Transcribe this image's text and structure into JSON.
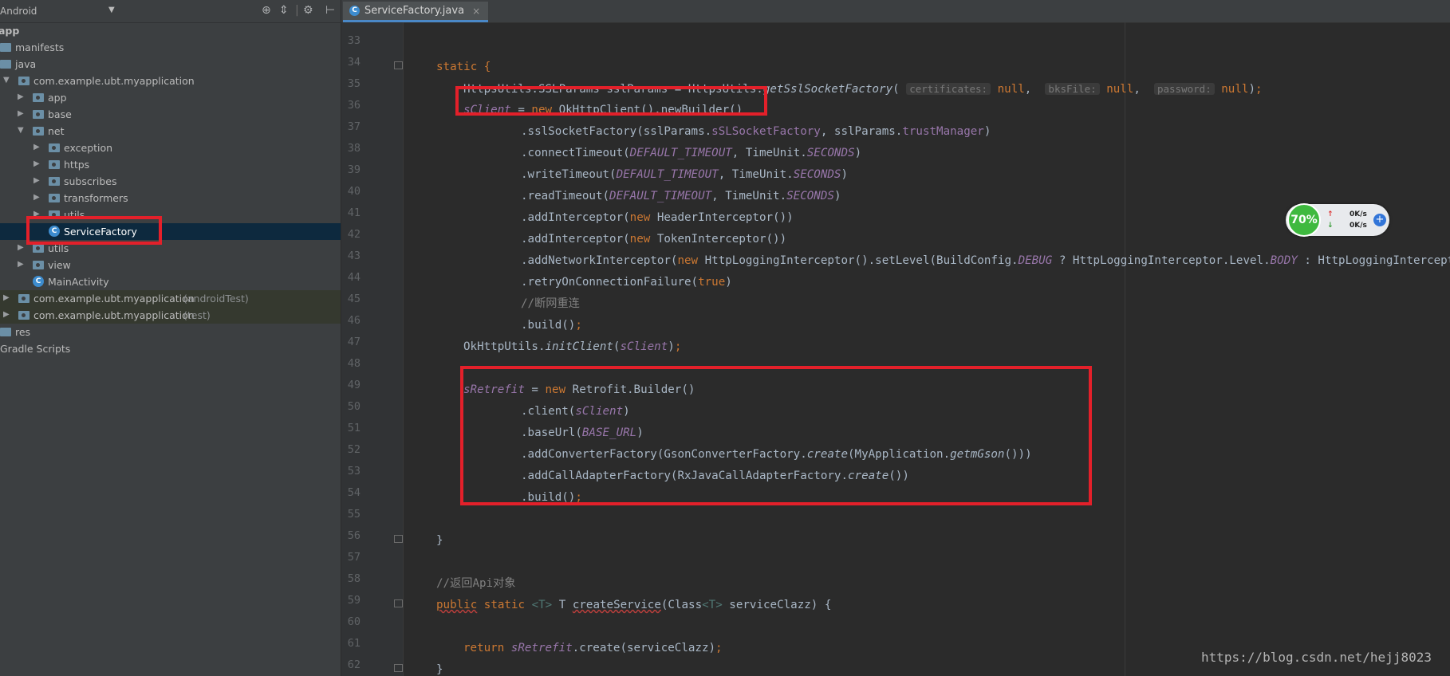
{
  "project": {
    "view_mode": "Android",
    "tree": [
      {
        "label": "app",
        "bold": true,
        "type": "module"
      },
      {
        "label": "manifests",
        "type": "folder"
      },
      {
        "label": "java",
        "type": "folder"
      },
      {
        "label": "com.example.ubt.myapplication",
        "type": "package",
        "expanded": true
      },
      {
        "label": "app",
        "type": "package"
      },
      {
        "label": "base",
        "type": "package"
      },
      {
        "label": "net",
        "type": "package",
        "expanded": true
      },
      {
        "label": "exception",
        "type": "package"
      },
      {
        "label": "https",
        "type": "package"
      },
      {
        "label": "subscribes",
        "type": "package"
      },
      {
        "label": "transformers",
        "type": "package"
      },
      {
        "label": "utils",
        "type": "package"
      },
      {
        "label": "ServiceFactory",
        "type": "class",
        "selected": true
      },
      {
        "label": "utils",
        "type": "package"
      },
      {
        "label": "view",
        "type": "package"
      },
      {
        "label": "MainActivity",
        "type": "class"
      },
      {
        "label": "com.example.ubt.myapplication",
        "suffix": "(androidTest)",
        "type": "package"
      },
      {
        "label": "com.example.ubt.myapplication",
        "suffix": "(test)",
        "type": "package"
      },
      {
        "label": "res",
        "type": "folder"
      },
      {
        "label": "Gradle Scripts",
        "type": "gradle"
      }
    ]
  },
  "editor": {
    "tab": {
      "label": "ServiceFactory.java",
      "close": "×"
    },
    "line_numbers": [
      "33",
      "34",
      "35",
      "36",
      "37",
      "38",
      "39",
      "40",
      "41",
      "42",
      "43",
      "44",
      "45",
      "46",
      "47",
      "48",
      "49",
      "50",
      "51",
      "52",
      "53",
      "54",
      "55",
      "56",
      "57",
      "58",
      "59",
      "60",
      "61",
      "62"
    ],
    "code": {
      "l34": "static {",
      "l35_a": "HttpsUtils.SSLParams sslParams = HttpsUtils.",
      "l35_m": "getSslSocketFactory",
      "l35_h1": "certificates:",
      "l35_h2": "bksFile:",
      "l35_h3": "password:",
      "null": "null",
      "l36_f": "sClient",
      "l36_b": " = ",
      "new": "new",
      "l36_c": " OkHttpClient().newBuilder()",
      "l37_a": ".sslSocketFactory(sslParams.",
      "l37_f": "sSLSocketFactory",
      "l37_b": ", sslParams.",
      "l37_g": "trustManager",
      "l37_c": ")",
      "connectTimeout": ".connectTimeout(",
      "writeTimeout": ".writeTimeout(",
      "readTimeout": ".readTimeout(",
      "default_timeout": "DEFAULT_TIMEOUT",
      "timeunit": ", TimeUnit.",
      "seconds": "SECONDS",
      "addInterceptor": ".addInterceptor(",
      "header_interceptor": " HeaderInterceptor())",
      "token_interceptor": " TokenInterceptor())",
      "l43_a": ".addNetworkInterceptor(",
      "l43_b": " HttpLoggingInterceptor().setLevel(BuildConfig.",
      "l43_debug": "DEBUG",
      "l43_c": " ? HttpLoggingInterceptor.Level.",
      "l43_body": "BODY",
      "l43_d": " : HttpLoggingInterceptor.Level.NONE))",
      "l44_a": ".retryOnConnectionFailure(",
      "true": "true",
      "l45": "//断网重连",
      "build": ".build()",
      "semi": ";",
      "l47_a": "OkHttpUtils.",
      "l47_m": "initClient",
      "l47_f": "sClient",
      "l49_f": "sRetrefit",
      "l49_c": " Retrofit.Builder()",
      "l50_a": ".client(",
      "l50_f": "sClient",
      "l51_a": ".baseUrl(",
      "l51_f": "BASE_URL",
      "l52_a": ".addConverterFactory(GsonConverterFactory.",
      "create": "create",
      "l52_b": "(MyApplication.",
      "l52_m": "getmGson",
      "l52_c": "()))",
      "l53_a": ".addCallAdapterFactory(RxJavaCallAdapterFactory.",
      "l53_c": "())",
      "close_brace": "}",
      "l58": "//返回Api对象",
      "l59_pub": "public",
      "l59_static": "static",
      "l59_t1": "<T>",
      "l59_t2": " T ",
      "l59_m": "createService",
      "l59_b": "(Class",
      "l59_c": " serviceClazz) {",
      "l61_ret": "return",
      "l61_f": "sRetrefit",
      "l61_b": ".create(serviceClazz)"
    }
  },
  "net_widget": {
    "cpu": "70%",
    "up": "0K/s",
    "down": "0K/s",
    "up_arrow": "↑",
    "down_arrow": "↓",
    "plus": "+"
  },
  "watermark": "https://blog.csdn.net/hejj8023",
  "colors": {
    "highlight_box": "#e3202a",
    "selected_row": "#0d293e",
    "keyword": "#cc7832",
    "field": "#9876aa"
  }
}
